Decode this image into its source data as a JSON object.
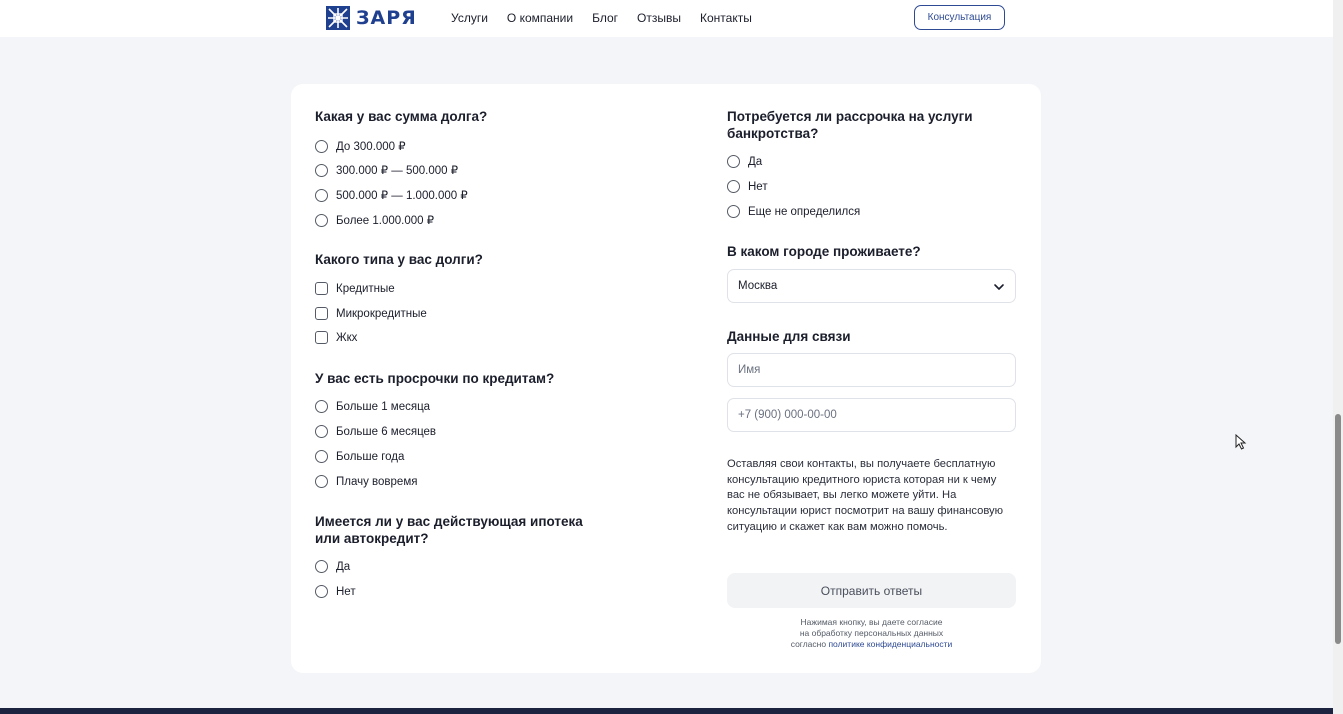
{
  "header": {
    "logo_text": "ЗАРЯ",
    "nav": [
      "Услуги",
      "О компании",
      "Блог",
      "Отзывы",
      "Контакты"
    ],
    "consult_button": "Консультация"
  },
  "form": {
    "q_debt_sum": {
      "title": "Какая у вас сумма долга?",
      "options": [
        "До 300.000 ₽",
        "300.000 ₽ — 500.000 ₽",
        "500.000 ₽ — 1.000.000 ₽",
        "Более 1.000.000 ₽"
      ]
    },
    "q_debt_type": {
      "title": "Какого типа у вас долги?",
      "options": [
        "Кредитные",
        "Микрокредитные",
        "Жкх"
      ]
    },
    "q_overdue": {
      "title": "У вас есть просрочки по кредитам?",
      "options": [
        "Больше 1 месяца",
        "Больше 6 месяцев",
        "Больше года",
        "Плачу вовремя"
      ]
    },
    "q_mortgage": {
      "title_line1": "Имеется ли у вас действующая ипотека",
      "title_line2": "или автокредит?",
      "options": [
        "Да",
        "Нет"
      ]
    },
    "q_installment": {
      "title_line1": "Потребуется ли рассрочка на услуги",
      "title_line2": "банкротства?",
      "options": [
        "Да",
        "Нет",
        "Еще не определился"
      ]
    },
    "q_city": {
      "title": "В каком городе проживаете?",
      "selected": "Москва"
    },
    "contacts": {
      "title": "Данные для связи",
      "name_placeholder": "Имя",
      "phone_placeholder": "+7 (900) 000-00-00"
    },
    "note": "Оставляя свои контакты, вы получаете бесплатную консультацию кредитного юриста которая ни к чему вас не обязывает, вы легко можете уйти. На консультации юрист посмотрит на вашу финансовую ситуацию и скажет как вам можно помочь.",
    "submit_label": "Отправить ответы",
    "consent_line1": "Нажимая кнопку, вы даете согласие",
    "consent_line2": "на обработку персональных данных",
    "consent_line3_prefix": "согласно",
    "consent_link": "политике конфиденциальности"
  }
}
